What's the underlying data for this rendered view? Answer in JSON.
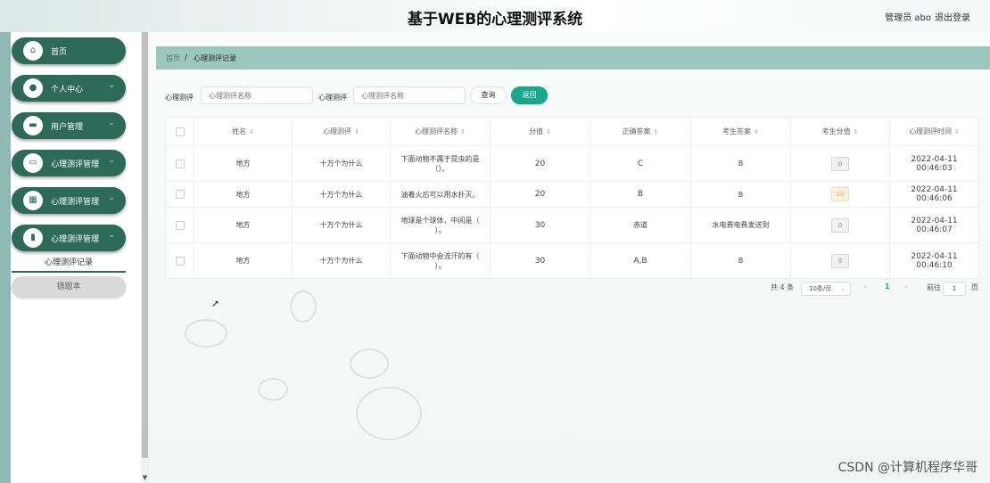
{
  "header": {
    "title": "基于WEB的心理测评系统",
    "user": "管理员 abo",
    "logout": "退出登录"
  },
  "sidebar": {
    "items": [
      {
        "label": "首页",
        "icon": "home-icon",
        "has_submenu": false
      },
      {
        "label": "个人中心",
        "icon": "user-icon",
        "has_submenu": true
      },
      {
        "label": "用户管理",
        "icon": "card-icon",
        "has_submenu": true
      },
      {
        "label": "心理测评管理",
        "icon": "briefcase-icon",
        "has_submenu": true
      },
      {
        "label": "心理测评管理",
        "icon": "grid-icon",
        "has_submenu": true
      },
      {
        "label": "心理测评管理",
        "icon": "chart-icon",
        "has_submenu": true
      }
    ],
    "active_subitem": "心理测评记录",
    "notebook": "错题本"
  },
  "breadcrumb": {
    "home": "首页",
    "separator": "/",
    "current": "心理测评记录"
  },
  "search": {
    "label1": "心理测评",
    "placeholder1": "心理测评名称",
    "label2": "心理测评",
    "placeholder2": "心理测评名称",
    "query_button": "查询",
    "back_button": "返回"
  },
  "table": {
    "headers": [
      "姓名",
      "心理测评",
      "心理测评名称",
      "分值",
      "正确答案",
      "考生答案",
      "考生分值",
      "心理测评时间"
    ],
    "rows": [
      {
        "name": "地方",
        "assessment": "十万个为什么",
        "question": "下面动物不属于昆虫的是（）。",
        "value": "20",
        "correct": "C",
        "answer": "B",
        "score": "0",
        "score_warn": false,
        "time": "2022-04-11 00:46:03"
      },
      {
        "name": "地方",
        "assessment": "十万个为什么",
        "question": "油着火后可以用水扑灭。",
        "value": "20",
        "correct": "B",
        "answer": "B",
        "score": "20",
        "score_warn": true,
        "time": "2022-04-11 00:46:06"
      },
      {
        "name": "地方",
        "assessment": "十万个为什么",
        "question": "地球是个球体，中间是（ ）。",
        "value": "30",
        "correct": "赤道",
        "answer": "水电费电费发送到",
        "score": "0",
        "score_warn": false,
        "time": "2022-04-11 00:46:07"
      },
      {
        "name": "地方",
        "assessment": "十万个为什么",
        "question": "下面动物中会流汗的有（ ）。",
        "value": "30",
        "correct": "A,B",
        "answer": "B",
        "score": "0",
        "score_warn": false,
        "time": "2022-04-11 00:46:10"
      }
    ]
  },
  "pagination": {
    "total": "共 4 条",
    "page_size": "10条/页",
    "prev": "‹",
    "current_page": "1",
    "next": "›",
    "goto_label": "前往",
    "goto_value": "1",
    "goto_unit": "页"
  },
  "watermark": "CSDN @计算机程序华哥",
  "colors": {
    "primary": "#2d6a57",
    "accent": "#19a88f",
    "breadcrumb_bg": "#9cc7bc"
  }
}
